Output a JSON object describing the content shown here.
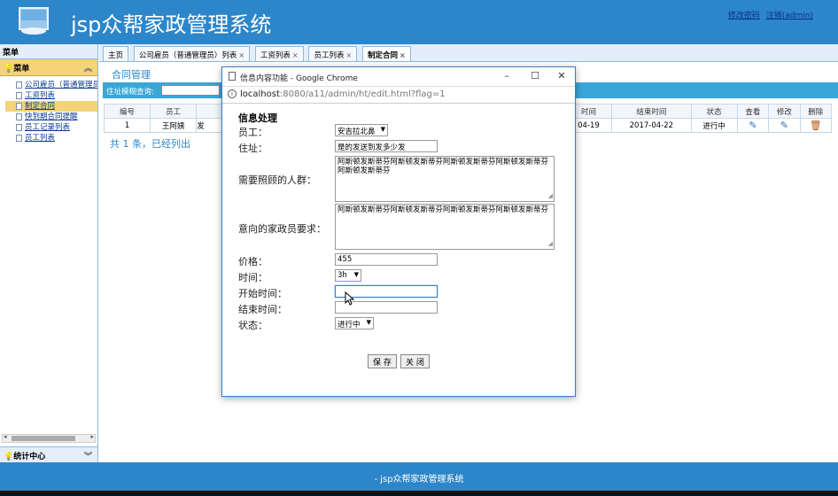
{
  "app": {
    "title": "jsp众帮家政管理系统"
  },
  "header_links": {
    "change_password": "修改密码",
    "logout": "注销(admin)"
  },
  "sidebar": {
    "title": "菜单",
    "panel_title": "菜单",
    "items": [
      {
        "label": "公司雇员（普通管理员）"
      },
      {
        "label": "工资列表"
      },
      {
        "label": "制定合同"
      },
      {
        "label": "快到期合同提醒"
      },
      {
        "label": "员工记录列表"
      },
      {
        "label": "员工列表"
      }
    ],
    "stats_title": "统计中心"
  },
  "tabs": [
    {
      "label": "主页"
    },
    {
      "label": "公司雇员（普通管理员）列表"
    },
    {
      "label": "工资列表"
    },
    {
      "label": "员工列表"
    },
    {
      "label": "制定合同"
    }
  ],
  "main": {
    "section_title": "合同管理",
    "search_label": "住址模糊查询:",
    "summary": "共 1 条，已经列出"
  },
  "table": {
    "headers": [
      "编号",
      "员工",
      "",
      "时间",
      "结束时间",
      "状态",
      "查看",
      "修改",
      "删除"
    ],
    "rows": [
      {
        "id": "1",
        "employee": "王阿姨",
        "col3": "发",
        "time": "04-19",
        "end_time": "2017-04-22",
        "status": "进行中"
      }
    ]
  },
  "dialog": {
    "window_title": "信息内容功能 - Google Chrome",
    "url_host": "localhost",
    "url_path": ":8080/a11/admin/ht/edit.html?flag=1",
    "form_title": "信息处理",
    "fields": {
      "employee_label": "员工：",
      "employee_value": "安吉拉北鼻",
      "address_label": "住址：",
      "address_value": "是的发送到发多少发",
      "care_label": "需要照顾的人群：",
      "care_value": "阿斯顿发斯蒂芬阿斯顿发斯蒂芬阿斯顿发斯蒂芬阿斯顿发斯蒂芬阿斯顿发斯蒂芬",
      "requirement_label": "意向的家政员要求：",
      "requirement_value": "阿斯顿发斯蒂芬阿斯顿发斯蒂芬阿斯顿发斯蒂芬阿斯顿发斯蒂芬",
      "price_label": "价格：",
      "price_value": "455",
      "time_label": "时间：",
      "time_value": "3h",
      "start_label": "开始时间：",
      "start_value": "",
      "end_label": "结束时间：",
      "end_value": "",
      "status_label": "状态：",
      "status_value": "进行中"
    },
    "save_label": "保 存",
    "close_label": "关 闭"
  },
  "footer": {
    "text": "- jsp众帮家政管理系统"
  },
  "colors": {
    "header": "#2d86c9",
    "accent": "#3aa6d8",
    "active_menu": "#f4d37a"
  }
}
